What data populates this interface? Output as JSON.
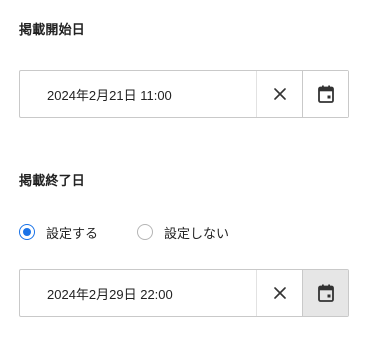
{
  "start_section": {
    "label": "掲載開始日",
    "datetime_value": "2024年2月21日 11:00",
    "clear_icon": "close-icon",
    "calendar_icon": "calendar-icon"
  },
  "end_section": {
    "label": "掲載終了日",
    "radio_options": [
      {
        "label": "設定する",
        "checked": true
      },
      {
        "label": "設定しない",
        "checked": false
      }
    ],
    "datetime_value": "2024年2月29日 22:00",
    "clear_icon": "close-icon",
    "calendar_icon": "calendar-icon",
    "calendar_button_state": "active"
  },
  "colors": {
    "accent": "#1a73e8",
    "border": "#c9c9c9",
    "text": "#222222",
    "active_button_bg": "#e6e6e6"
  }
}
